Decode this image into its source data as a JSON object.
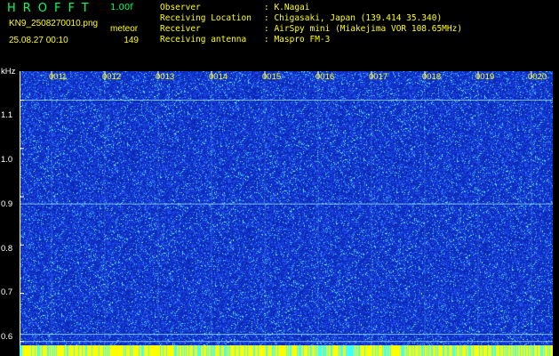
{
  "header": {
    "app_name": "HROFFT",
    "version": "1.00f",
    "filename": "KN9_2508270010.png",
    "mode": "meteor",
    "datetime": "25.08.27 00:10",
    "count": "149",
    "colors": {
      "app_name": "#00ff66",
      "version": "#00ff66",
      "info": "#ffff00"
    },
    "meta": [
      {
        "label": "Observer",
        "value": ": K.Nagai"
      },
      {
        "label": "Receiving Location",
        "value": ": Chigasaki, Japan (139.414 35.340)"
      },
      {
        "label": "Receiver",
        "value": ": AirSpy mini (Miakejima VOR 108.65MHz)"
      },
      {
        "label": "Receiving antenna",
        "value": ": Maspro FM-3"
      }
    ]
  },
  "spectrogram": {
    "unit": "kHz",
    "time_ticks": [
      "0011",
      "0012",
      "0013",
      "0014",
      "0015",
      "0016",
      "0017",
      "0018",
      "0019",
      "0020"
    ],
    "freq_ticks": [
      "1.1",
      "1.0",
      "0.9",
      "0.8",
      "0.7",
      "0.6"
    ],
    "freq_range_khz": [
      0.57,
      1.16
    ],
    "colors": {
      "background": "#0a2ab4",
      "noise_low": "#3c64ff",
      "noise_high": "#78ffff",
      "axis": "#ffffff",
      "tick_labels": "#ffff00",
      "bottom_bar": "#ffff00"
    },
    "carrier_lines_khz": [
      1.1,
      0.885,
      0.615,
      0.6
    ]
  }
}
